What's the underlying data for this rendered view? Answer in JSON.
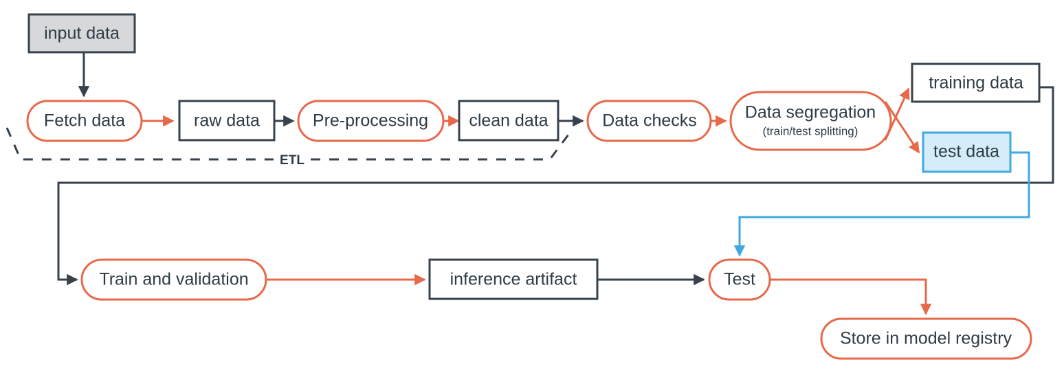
{
  "diagram": {
    "title": "ML pipeline flowchart",
    "colors": {
      "orange": "#e8684a",
      "dark": "#37424c",
      "blue": "#3fa9e0",
      "blue_fill": "#d4edf9",
      "gray_fill": "#d6d8da",
      "white": "#ffffff"
    },
    "nodes": [
      {
        "id": "input-data",
        "label": "input data",
        "shape": "rect",
        "style": "gray"
      },
      {
        "id": "fetch-data",
        "label": "Fetch data",
        "shape": "round",
        "style": "orange"
      },
      {
        "id": "raw-data",
        "label": "raw data",
        "shape": "rect",
        "style": "dark"
      },
      {
        "id": "pre-processing",
        "label": "Pre-processing",
        "shape": "round",
        "style": "orange"
      },
      {
        "id": "clean-data",
        "label": "clean data",
        "shape": "rect",
        "style": "dark"
      },
      {
        "id": "data-checks",
        "label": "Data checks",
        "shape": "round",
        "style": "orange"
      },
      {
        "id": "data-segregation",
        "label": "Data segregation",
        "sublabel": "(train/test splitting)",
        "shape": "round",
        "style": "orange"
      },
      {
        "id": "training-data",
        "label": "training data",
        "shape": "rect",
        "style": "dark"
      },
      {
        "id": "test-data",
        "label": "test data",
        "shape": "rect",
        "style": "blue"
      },
      {
        "id": "train-and-validation",
        "label": "Train and validation",
        "shape": "round",
        "style": "orange"
      },
      {
        "id": "inference-artifact",
        "label": "inference artifact",
        "shape": "rect",
        "style": "dark"
      },
      {
        "id": "test",
        "label": "Test",
        "shape": "round",
        "style": "orange"
      },
      {
        "id": "store-in-model-registry",
        "label": "Store in model registry",
        "shape": "round",
        "style": "orange"
      }
    ],
    "groups": [
      {
        "id": "etl-group",
        "label": "ETL"
      }
    ],
    "edges": [
      {
        "from": "input-data",
        "to": "fetch-data",
        "color": "dark"
      },
      {
        "from": "fetch-data",
        "to": "raw-data",
        "color": "orange"
      },
      {
        "from": "raw-data",
        "to": "pre-processing",
        "color": "dark"
      },
      {
        "from": "pre-processing",
        "to": "clean-data",
        "color": "orange"
      },
      {
        "from": "clean-data",
        "to": "data-checks",
        "color": "dark"
      },
      {
        "from": "data-checks",
        "to": "data-segregation",
        "color": "orange"
      },
      {
        "from": "data-segregation",
        "to": "training-data",
        "color": "orange"
      },
      {
        "from": "data-segregation",
        "to": "test-data",
        "color": "orange"
      },
      {
        "from": "training-data",
        "to": "train-and-validation",
        "color": "dark"
      },
      {
        "from": "train-and-validation",
        "to": "inference-artifact",
        "color": "orange"
      },
      {
        "from": "inference-artifact",
        "to": "test",
        "color": "dark"
      },
      {
        "from": "test-data",
        "to": "test",
        "color": "blue"
      },
      {
        "from": "test",
        "to": "store-in-model-registry",
        "color": "orange"
      }
    ]
  }
}
